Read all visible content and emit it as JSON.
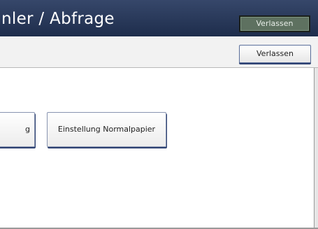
{
  "header": {
    "title": "nler / Abfrage",
    "exit_label": "Verlassen"
  },
  "toolbar": {
    "exit_label": "Verlassen"
  },
  "content": {
    "buttons": [
      {
        "label": "g"
      },
      {
        "label": "Einstellung Normalpapier"
      }
    ]
  }
}
